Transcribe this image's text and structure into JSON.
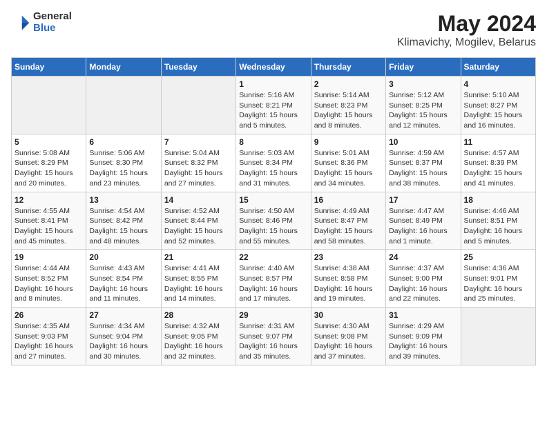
{
  "header": {
    "logo_line1": "General",
    "logo_line2": "Blue",
    "title": "May 2024",
    "subtitle": "Klimavichy, Mogilev, Belarus"
  },
  "days_of_week": [
    "Sunday",
    "Monday",
    "Tuesday",
    "Wednesday",
    "Thursday",
    "Friday",
    "Saturday"
  ],
  "weeks": [
    [
      {
        "num": "",
        "detail": "",
        "empty": true
      },
      {
        "num": "",
        "detail": "",
        "empty": true
      },
      {
        "num": "",
        "detail": "",
        "empty": true
      },
      {
        "num": "1",
        "detail": "Sunrise: 5:16 AM\nSunset: 8:21 PM\nDaylight: 15 hours\nand 5 minutes.",
        "empty": false
      },
      {
        "num": "2",
        "detail": "Sunrise: 5:14 AM\nSunset: 8:23 PM\nDaylight: 15 hours\nand 8 minutes.",
        "empty": false
      },
      {
        "num": "3",
        "detail": "Sunrise: 5:12 AM\nSunset: 8:25 PM\nDaylight: 15 hours\nand 12 minutes.",
        "empty": false
      },
      {
        "num": "4",
        "detail": "Sunrise: 5:10 AM\nSunset: 8:27 PM\nDaylight: 15 hours\nand 16 minutes.",
        "empty": false
      }
    ],
    [
      {
        "num": "5",
        "detail": "Sunrise: 5:08 AM\nSunset: 8:29 PM\nDaylight: 15 hours\nand 20 minutes.",
        "empty": false
      },
      {
        "num": "6",
        "detail": "Sunrise: 5:06 AM\nSunset: 8:30 PM\nDaylight: 15 hours\nand 23 minutes.",
        "empty": false
      },
      {
        "num": "7",
        "detail": "Sunrise: 5:04 AM\nSunset: 8:32 PM\nDaylight: 15 hours\nand 27 minutes.",
        "empty": false
      },
      {
        "num": "8",
        "detail": "Sunrise: 5:03 AM\nSunset: 8:34 PM\nDaylight: 15 hours\nand 31 minutes.",
        "empty": false
      },
      {
        "num": "9",
        "detail": "Sunrise: 5:01 AM\nSunset: 8:36 PM\nDaylight: 15 hours\nand 34 minutes.",
        "empty": false
      },
      {
        "num": "10",
        "detail": "Sunrise: 4:59 AM\nSunset: 8:37 PM\nDaylight: 15 hours\nand 38 minutes.",
        "empty": false
      },
      {
        "num": "11",
        "detail": "Sunrise: 4:57 AM\nSunset: 8:39 PM\nDaylight: 15 hours\nand 41 minutes.",
        "empty": false
      }
    ],
    [
      {
        "num": "12",
        "detail": "Sunrise: 4:55 AM\nSunset: 8:41 PM\nDaylight: 15 hours\nand 45 minutes.",
        "empty": false
      },
      {
        "num": "13",
        "detail": "Sunrise: 4:54 AM\nSunset: 8:42 PM\nDaylight: 15 hours\nand 48 minutes.",
        "empty": false
      },
      {
        "num": "14",
        "detail": "Sunrise: 4:52 AM\nSunset: 8:44 PM\nDaylight: 15 hours\nand 52 minutes.",
        "empty": false
      },
      {
        "num": "15",
        "detail": "Sunrise: 4:50 AM\nSunset: 8:46 PM\nDaylight: 15 hours\nand 55 minutes.",
        "empty": false
      },
      {
        "num": "16",
        "detail": "Sunrise: 4:49 AM\nSunset: 8:47 PM\nDaylight: 15 hours\nand 58 minutes.",
        "empty": false
      },
      {
        "num": "17",
        "detail": "Sunrise: 4:47 AM\nSunset: 8:49 PM\nDaylight: 16 hours\nand 1 minute.",
        "empty": false
      },
      {
        "num": "18",
        "detail": "Sunrise: 4:46 AM\nSunset: 8:51 PM\nDaylight: 16 hours\nand 5 minutes.",
        "empty": false
      }
    ],
    [
      {
        "num": "19",
        "detail": "Sunrise: 4:44 AM\nSunset: 8:52 PM\nDaylight: 16 hours\nand 8 minutes.",
        "empty": false
      },
      {
        "num": "20",
        "detail": "Sunrise: 4:43 AM\nSunset: 8:54 PM\nDaylight: 16 hours\nand 11 minutes.",
        "empty": false
      },
      {
        "num": "21",
        "detail": "Sunrise: 4:41 AM\nSunset: 8:55 PM\nDaylight: 16 hours\nand 14 minutes.",
        "empty": false
      },
      {
        "num": "22",
        "detail": "Sunrise: 4:40 AM\nSunset: 8:57 PM\nDaylight: 16 hours\nand 17 minutes.",
        "empty": false
      },
      {
        "num": "23",
        "detail": "Sunrise: 4:38 AM\nSunset: 8:58 PM\nDaylight: 16 hours\nand 19 minutes.",
        "empty": false
      },
      {
        "num": "24",
        "detail": "Sunrise: 4:37 AM\nSunset: 9:00 PM\nDaylight: 16 hours\nand 22 minutes.",
        "empty": false
      },
      {
        "num": "25",
        "detail": "Sunrise: 4:36 AM\nSunset: 9:01 PM\nDaylight: 16 hours\nand 25 minutes.",
        "empty": false
      }
    ],
    [
      {
        "num": "26",
        "detail": "Sunrise: 4:35 AM\nSunset: 9:03 PM\nDaylight: 16 hours\nand 27 minutes.",
        "empty": false
      },
      {
        "num": "27",
        "detail": "Sunrise: 4:34 AM\nSunset: 9:04 PM\nDaylight: 16 hours\nand 30 minutes.",
        "empty": false
      },
      {
        "num": "28",
        "detail": "Sunrise: 4:32 AM\nSunset: 9:05 PM\nDaylight: 16 hours\nand 32 minutes.",
        "empty": false
      },
      {
        "num": "29",
        "detail": "Sunrise: 4:31 AM\nSunset: 9:07 PM\nDaylight: 16 hours\nand 35 minutes.",
        "empty": false
      },
      {
        "num": "30",
        "detail": "Sunrise: 4:30 AM\nSunset: 9:08 PM\nDaylight: 16 hours\nand 37 minutes.",
        "empty": false
      },
      {
        "num": "31",
        "detail": "Sunrise: 4:29 AM\nSunset: 9:09 PM\nDaylight: 16 hours\nand 39 minutes.",
        "empty": false
      },
      {
        "num": "",
        "detail": "",
        "empty": true
      }
    ]
  ]
}
